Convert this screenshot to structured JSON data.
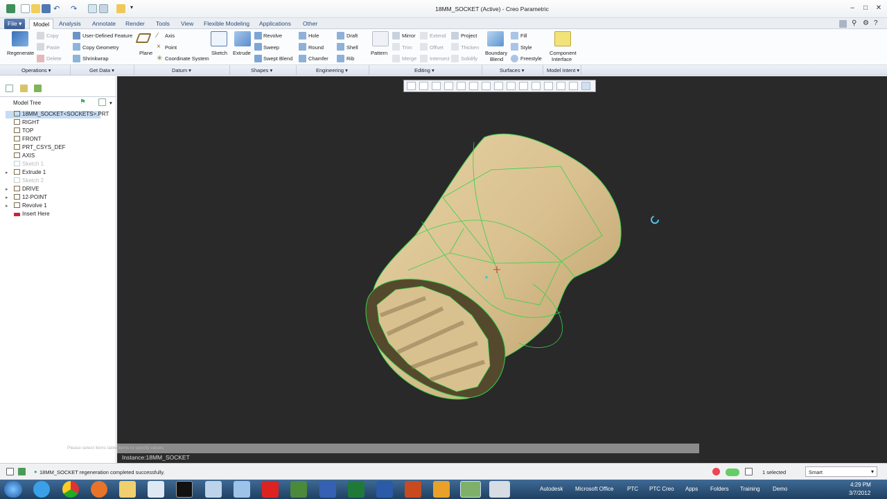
{
  "window": {
    "title": "18MM_SOCKET (Active) - Creo Parametric"
  },
  "tabs": [
    "File",
    "Model",
    "Analysis",
    "Annotate",
    "Render",
    "Tools",
    "View",
    "Flexible Modeling",
    "Applications",
    "Other"
  ],
  "ribbon": {
    "operations": {
      "regenerate": "Regenerate",
      "copy": "Copy",
      "paste": "Paste",
      "delete": "Delete",
      "group": "Operations"
    },
    "get_data": {
      "udf": "User-Defined Feature",
      "copy_geometry": "Copy Geometry",
      "shrinkwrap": "Shrinkwrap",
      "group": "Get Data"
    },
    "datum": {
      "plane": "Plane",
      "axis": "Axis",
      "point": "Point",
      "csys": "Coordinate System",
      "sketch": "Sketch",
      "group": "Datum"
    },
    "shapes": {
      "extrude": "Extrude",
      "revolve": "Revolve",
      "sweep": "Sweep",
      "swept_blend": "Swept Blend",
      "group": "Shapes"
    },
    "engineering": {
      "hole": "Hole",
      "round": "Round",
      "chamfer": "Chamfer",
      "draft": "Draft",
      "shell": "Shell",
      "rib": "Rib",
      "group": "Engineering"
    },
    "editing": {
      "pattern": "Pattern",
      "mirror": "Mirror",
      "trim": "Trim",
      "merge": "Merge",
      "extend": "Extend",
      "offset": "Offset",
      "intersect": "Intersect",
      "project": "Project",
      "thicken": "Thicken",
      "solidify": "Solidify",
      "group": "Editing"
    },
    "surfaces": {
      "boundary_blend_1": "Boundary",
      "boundary_blend_2": "Blend",
      "fill": "Fill",
      "style": "Style",
      "freestyle": "Freestyle",
      "group": "Surfaces"
    },
    "model_intent": {
      "component_interface_1": "Component",
      "component_interface_2": "Interface",
      "group": "Model Intent"
    }
  },
  "model_tree": {
    "header": "Model Tree",
    "items": [
      {
        "label": "18MM_SOCKET<SOCKETS>.PRT",
        "expander": "",
        "icon": "part-icon",
        "dim": false,
        "selected": true
      },
      {
        "label": "RIGHT",
        "expander": "",
        "icon": "datum-plane-icon",
        "dim": false
      },
      {
        "label": "TOP",
        "expander": "",
        "icon": "datum-plane-icon",
        "dim": false
      },
      {
        "label": "FRONT",
        "expander": "",
        "icon": "datum-plane-icon",
        "dim": false
      },
      {
        "label": "PRT_CSYS_DEF",
        "expander": "",
        "icon": "csys-icon",
        "dim": false
      },
      {
        "label": "AXIS",
        "expander": "",
        "icon": "axis-icon",
        "dim": false
      },
      {
        "label": "Sketch 1",
        "expander": "",
        "icon": "sketch-icon",
        "dim": true
      },
      {
        "label": "Extrude 1",
        "expander": "▸",
        "icon": "extrude-icon",
        "dim": false
      },
      {
        "label": "Sketch 2",
        "expander": "",
        "icon": "sketch-icon",
        "dim": true
      },
      {
        "label": "DRIVE",
        "expander": "▸",
        "icon": "extrude-icon",
        "dim": false
      },
      {
        "label": "12-POINT",
        "expander": "▸",
        "icon": "extrude-icon",
        "dim": false
      },
      {
        "label": "Revolve 1",
        "expander": "▸",
        "icon": "revolve-icon",
        "dim": false
      },
      {
        "label": "Insert Here",
        "expander": "",
        "icon": "insert-arrow-icon",
        "dim": false
      }
    ]
  },
  "viewport": {
    "message": "Please select items table items to specify values",
    "instance": "Instance:18MM_SOCKET"
  },
  "status": {
    "message": "18MM_SOCKET regeneration completed successfully.",
    "selected": "1 selected",
    "filter": "Smart"
  },
  "taskbar": {
    "links": [
      "Autodesk",
      "Microsoft Office",
      "PTC",
      "PTC Creo",
      "Apps",
      "Folders",
      "Training",
      "Demo"
    ],
    "time": "4:29 PM",
    "date": "3/7/2012"
  },
  "colors": {
    "viewport_bg": "#292929",
    "part_shade": "#d9c08f",
    "edge_highlight": "#35d04a",
    "selection": "#c6dcf3"
  }
}
